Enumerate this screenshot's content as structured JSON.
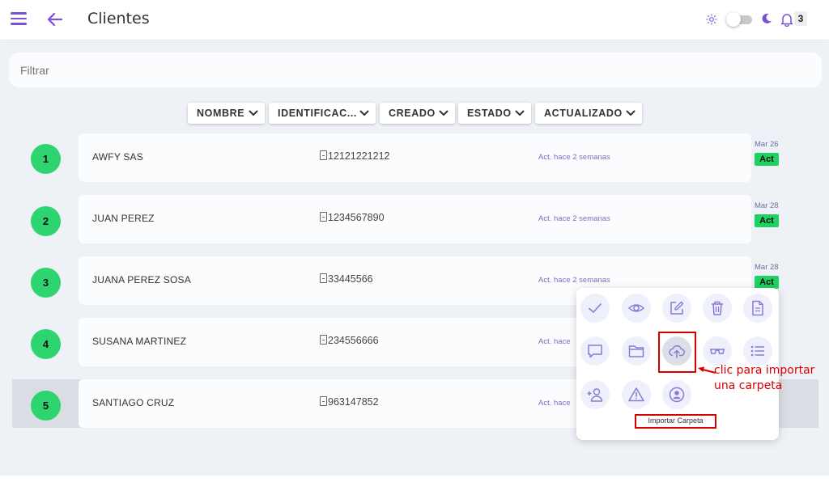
{
  "header": {
    "title": "Clientes",
    "notification_count": "3",
    "colors": {
      "accent": "#7b52d6"
    }
  },
  "filter": {
    "placeholder": "Filtrar"
  },
  "sort_buttons": [
    {
      "label": "NOMBRE"
    },
    {
      "label": "IDENTIFICAC..."
    },
    {
      "label": "CREADO"
    },
    {
      "label": "ESTADO"
    },
    {
      "label": "ACTUALIZADO"
    }
  ],
  "rows": [
    {
      "num": "1",
      "name": "AWFY SAS",
      "id": "12121221212",
      "updated": "Act. hace 2 semanas",
      "date": "Mar 26",
      "status": "Act"
    },
    {
      "num": "2",
      "name": "JUAN PEREZ",
      "id": "1234567890",
      "updated": "Act. hace 2 semanas",
      "date": "Mar 28",
      "status": "Act"
    },
    {
      "num": "3",
      "name": "JUANA PEREZ SOSA",
      "id": "33445566",
      "updated": "Act. hace 2 semanas",
      "date": "Mar 28",
      "status": "Act"
    },
    {
      "num": "4",
      "name": "SUSANA MARTINEZ",
      "id": "234556666",
      "updated": "Act. hace",
      "date": "",
      "status": ""
    },
    {
      "num": "5",
      "name": "SANTIAGO CRUZ",
      "id": "963147852",
      "updated": "Act. hace",
      "date": "",
      "status": ""
    }
  ],
  "actions": {
    "icons": [
      "check-icon",
      "eye-icon",
      "edit-icon",
      "trash-icon",
      "document-icon",
      "comment-icon",
      "folder-icon",
      "cloud-upload-icon",
      "glasses-icon",
      "list-icon",
      "add-user-icon",
      "warning-icon",
      "user-circle-icon"
    ],
    "tooltip": "Importar Carpeta"
  },
  "annotation": {
    "text_line1": "clic para importar",
    "text_line2": "una carpeta"
  },
  "colors": {
    "status_green": "#1fd160",
    "badge_green": "#2ed46f",
    "annotation_red": "#d90000"
  }
}
